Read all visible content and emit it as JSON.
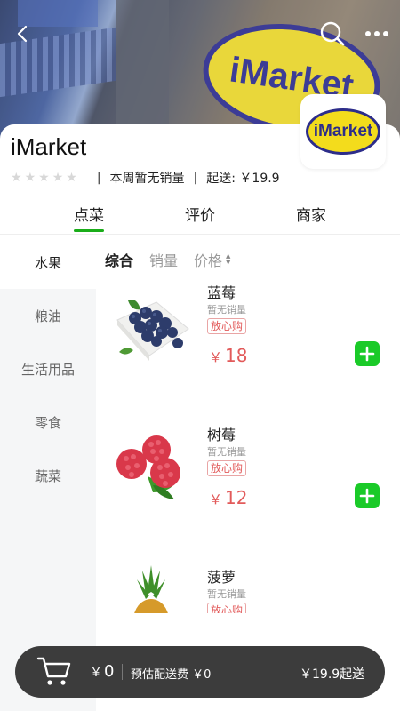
{
  "header": {
    "back_icon": "chevron-left-icon",
    "search_icon": "search-icon",
    "more_icon": "more-horizontal-icon",
    "banner_text": "iMarket"
  },
  "store": {
    "name": "iMarket",
    "logo_text": "iMarket",
    "rating_stars": 0,
    "weekly_sales": "本周暂无销量",
    "min_order": "起送: ￥19.9"
  },
  "tabs": [
    {
      "label": "点菜",
      "active": true
    },
    {
      "label": "评价",
      "active": false
    },
    {
      "label": "商家",
      "active": false
    }
  ],
  "sidebar": {
    "items": [
      {
        "label": "水果",
        "active": true
      },
      {
        "label": "粮油",
        "active": false
      },
      {
        "label": "生活用品",
        "active": false
      },
      {
        "label": "零食",
        "active": false
      },
      {
        "label": "蔬菜",
        "active": false
      }
    ]
  },
  "sort": {
    "comprehensive": "综合",
    "sales": "销量",
    "price": "价格"
  },
  "products": [
    {
      "name": "蓝莓",
      "sales": "暂无销量",
      "badge": "放心购",
      "currency": "￥",
      "price": "18"
    },
    {
      "name": "树莓",
      "sales": "暂无销量",
      "badge": "放心购",
      "currency": "￥",
      "price": "12"
    },
    {
      "name": "菠萝",
      "sales": "暂无销量",
      "badge": "放心购",
      "currency": "￥",
      "price": ""
    }
  ],
  "cart": {
    "currency": "￥",
    "total": "0",
    "delivery": "预估配送费 ￥0",
    "min_order": "￥19.9起送"
  },
  "colors": {
    "accent_green": "#1aad19",
    "add_button": "#1aca28",
    "price_red": "#e25a5a",
    "cart_bar": "#3c3c3c",
    "logo_yellow": "#f3dc1c",
    "logo_blue": "#2d2d8a"
  }
}
